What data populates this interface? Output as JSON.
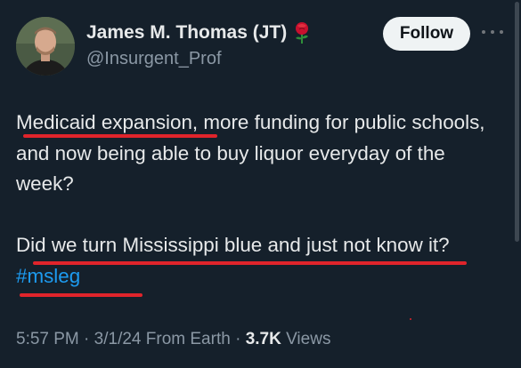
{
  "author": {
    "display_name": "James M. Thomas (JT)",
    "handle": "@Insurgent_Prof",
    "badge_icon": "rose-icon",
    "avatar_icon": "avatar"
  },
  "follow_button": {
    "label": "Follow"
  },
  "more_menu": {
    "icon": "more-icon"
  },
  "tweet": {
    "line_1": "Medicaid expansion, more funding for public schools, and now being able to buy liquor everyday of the week?",
    "p1_highlight": "Medicaid expansion",
    "p1_rest": ", more funding for public schools, and now being able to buy liquor everyday of the week?",
    "p2_text": "Did we turn Mississippi blue and just not know it? ",
    "hashtag": "#msleg"
  },
  "meta": {
    "time": "5:57 PM",
    "date": "3/1/24",
    "source": "From Earth",
    "views_count": "3.7K",
    "views_label": " Views",
    "separator": " · "
  },
  "colors": {
    "background": "#15202b",
    "text": "#e7e9ea",
    "secondary": "#8b98a5",
    "link": "#1d9bf0",
    "annotation": "#e0242b"
  }
}
